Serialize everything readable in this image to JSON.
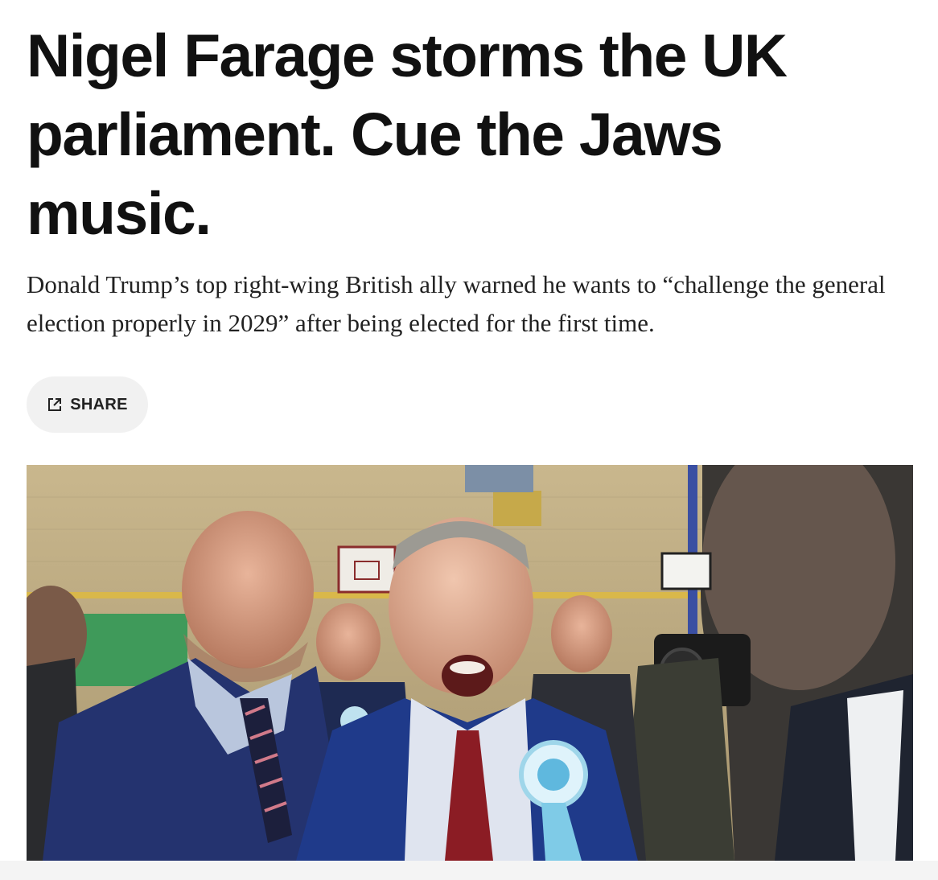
{
  "article": {
    "headline": "Nigel Farage storms the UK parliament. Cue the Jaws music.",
    "dek": "Donald Trump’s top right-wing British ally warned he wants to “challenge the general election properly in 2029” after being elected for the first time."
  },
  "actions": {
    "share_label": "SHARE",
    "share_icon": "external-link-icon"
  },
  "image": {
    "alt": ""
  }
}
